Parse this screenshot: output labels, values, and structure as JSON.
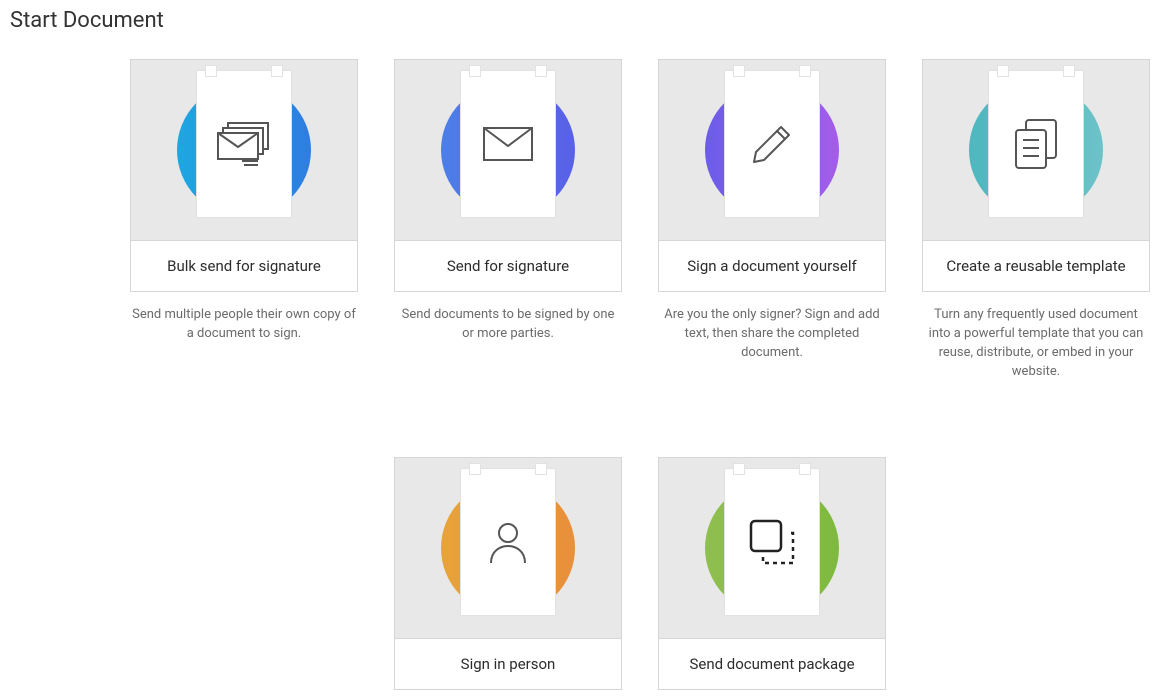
{
  "page_title": "Start Document",
  "cards": {
    "bulk_send": {
      "label": "Bulk send for signature",
      "desc": "Send multiple people their own copy of a document to sign."
    },
    "send_sig": {
      "label": "Send for signature",
      "desc": "Send documents to be signed by one or more parties."
    },
    "sign_self": {
      "label": "Sign a document yourself",
      "desc": "Are you the only signer? Sign and add text, then share the completed document."
    },
    "template": {
      "label": "Create a reusable template",
      "desc": "Turn any frequently used document into a powerful template that you can reuse, distribute, or embed in your website."
    },
    "in_person": {
      "label": "Sign in person",
      "desc": ""
    },
    "package": {
      "label": "Send document package",
      "desc": ""
    }
  }
}
